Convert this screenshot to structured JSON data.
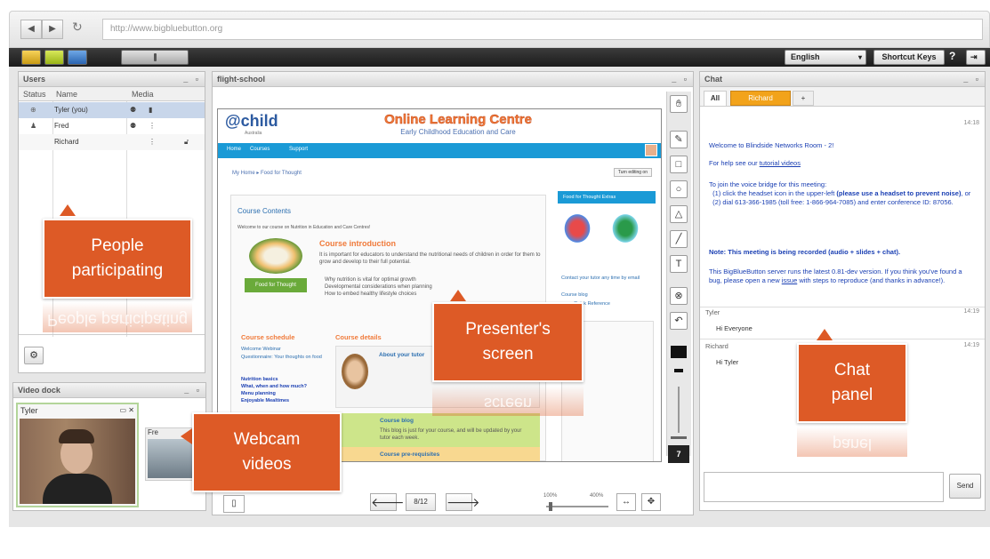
{
  "browser": {
    "url": "http://www.bigbluebutton.org",
    "back": "◀",
    "forward": "▶",
    "reload": "↻"
  },
  "toolbar": {
    "language": "English",
    "shortcut_keys": "Shortcut Keys",
    "help": "?",
    "logout": "⇥"
  },
  "users": {
    "title": "Users",
    "columns": [
      "Status",
      "Name",
      "Media"
    ],
    "rows": [
      {
        "name": "Tyler (you)"
      },
      {
        "name": "Fred"
      },
      {
        "name": "Richard"
      }
    ]
  },
  "video_dock": {
    "title": "Video dock",
    "cam1_name": "Tyler",
    "cam2_name": "Fre"
  },
  "presentation": {
    "title": "flight-school",
    "page": "8/12",
    "zoom_min": "100%",
    "zoom_max": "400%",
    "tool_page": "7"
  },
  "slide": {
    "logo": "child",
    "logo_sub": "Australia",
    "site_title": "Online Learning Centre",
    "site_subtitle": "Early Childhood Education and Care",
    "nav": [
      "Home",
      "Courses",
      "Support"
    ],
    "breadcrumb": "My Home ▸ Food for Thought",
    "turn_editing": "Turn editing on",
    "course_contents": "Course Contents",
    "welcome": "Welcome to our course on Nutrition in Education and Care Centres!",
    "food_btn": "Food for Thought",
    "intro_title": "Course introduction",
    "intro_text": "It is important for educators to understand the nutritional needs of children in order for them to grow and develop to their full potential.",
    "list": [
      "Why nutrition is vital for optimal growth",
      "Developmental considerations when planning",
      "How to embed healthy lifestyle choices"
    ],
    "left_section": "Course schedule",
    "links": [
      "Welcome Webinar",
      "Questionnaire: Your thoughts on food"
    ],
    "numbered": [
      "Nutrition basics",
      "What, when and how much?",
      "Menu planning",
      "Enjoyable Mealtimes"
    ],
    "mid_section": "Course details",
    "about_title": "About your tutor",
    "course_blog": "Course blog",
    "blog_text": "This blog is just for your course, and will be updated by your tutor each week.",
    "prereq": "Course pre-requisites",
    "sidebar_title": "Food for Thought Extras",
    "sidebar_link": "Contact your tutor any time by email",
    "course_blog_link": "Course blog",
    "quick_ref": "Quick Reference"
  },
  "chat": {
    "title": "Chat",
    "tabs": [
      "All",
      "Richard",
      "+"
    ],
    "time1": "14:18",
    "welcome": "Welcome to Blindside Networks Room - 2!",
    "help_prefix": "For help see our ",
    "help_link": "tutorial videos",
    "voice_intro": "To join the voice bridge for this meeting:",
    "voice_1a": "(1) click the headset icon in the upper-left ",
    "voice_1b": "(please use a headset to prevent noise)",
    "voice_1c": ", or",
    "voice_2": "(2) dial 613-366-1985 (toll free: 1-866-964-7085) and enter conference ID: 87056.",
    "recorded": "Note: This meeting is being recorded (audio + slides + chat).",
    "version_a": "This BigBlueButton server runs the latest 0.81-dev version. If you think you've found a bug, please open a new ",
    "version_link": "issue",
    "version_b": " with steps to reproduce (and thanks in advance!).",
    "messages": [
      {
        "user": "Tyler",
        "time": "14:19",
        "text": "Hi Everyone"
      },
      {
        "user": "Richard",
        "time": "14:19",
        "text": "Hi Tyler"
      }
    ],
    "send": "Send"
  },
  "annotations": {
    "people": [
      "People",
      "participating"
    ],
    "people_reflect": "People participating",
    "presenter": [
      "Presenter's",
      "screen"
    ],
    "presenter_reflect": "screen",
    "chat": [
      "Chat",
      "panel"
    ],
    "chat_reflect": "panel",
    "webcam": [
      "Webcam",
      "videos"
    ]
  },
  "colors": {
    "accent": "#dd5a26",
    "link": "#1a3fb3",
    "slide_nav": "#1a9ad6",
    "chat_tab": "#f2a31b"
  }
}
